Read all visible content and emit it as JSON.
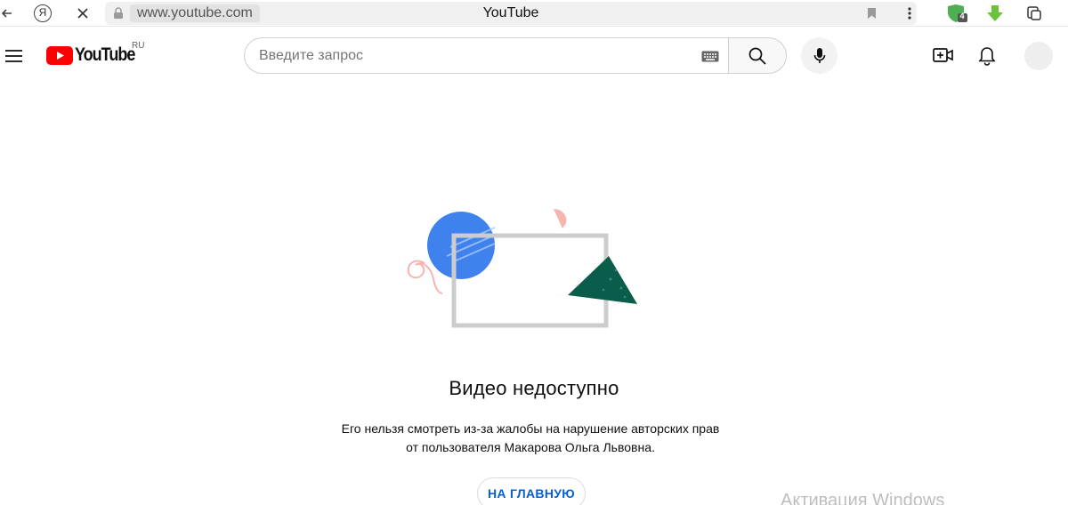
{
  "browser": {
    "url": "www.youtube.com",
    "page_title": "YouTube",
    "yandex_glyph": "Я",
    "extension_badge": "4"
  },
  "header": {
    "logo_text": "YouTube",
    "region": "RU",
    "search_placeholder": "Введите запрос"
  },
  "message": {
    "title": "Видео недоступно",
    "description": "Его нельзя смотреть из-за жалобы на нарушение авторских прав от пользователя Макарова Ольга Львовна.",
    "home_button": "НА ГЛАВНУЮ"
  },
  "watermark": "Активация Windows",
  "colors": {
    "brand_red": "#ff0000",
    "link_blue": "#065fd4",
    "illustration_blue": "#3f82ee",
    "illustration_green": "#0b5d4b",
    "illustration_pink": "#f7b4ae"
  }
}
